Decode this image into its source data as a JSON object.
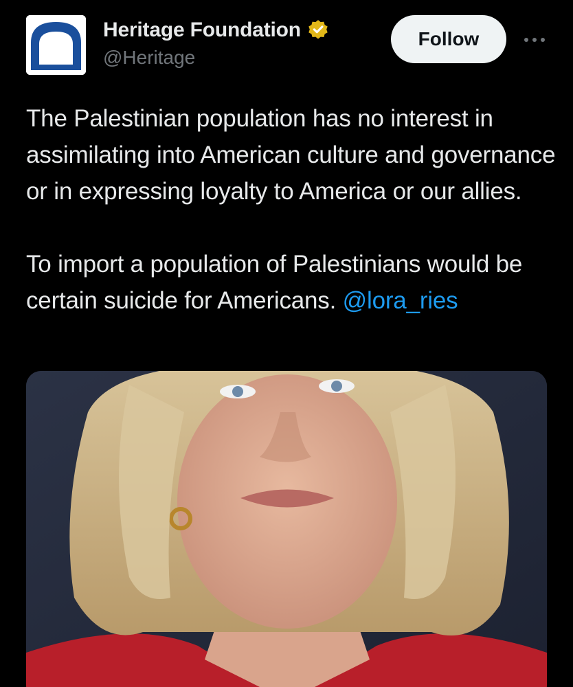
{
  "author": {
    "display_name": "Heritage Foundation",
    "handle": "@Heritage",
    "verified_badge": "gold-verified-icon",
    "avatar_icon": "liberty-bell-logo-icon",
    "brand_color": "#1a4f9c"
  },
  "actions": {
    "follow_label": "Follow",
    "more_icon": "more-options-icon"
  },
  "tweet": {
    "paragraph_1": "The Palestinian population has no interest in assimilating into American culture and governance or in expressing loyalty to America or our allies.",
    "paragraph_2_text": "To import a population of Palestinians would be certain suicide for Americans. ",
    "mention": "@lora_ries"
  },
  "media": {
    "type": "photo"
  },
  "colors": {
    "background": "#000000",
    "text": "#e7e9ea",
    "secondary_text": "#71767b",
    "link": "#1d9bf0",
    "follow_button_bg": "#eff3f4",
    "verified_gold": "#e2b719"
  }
}
